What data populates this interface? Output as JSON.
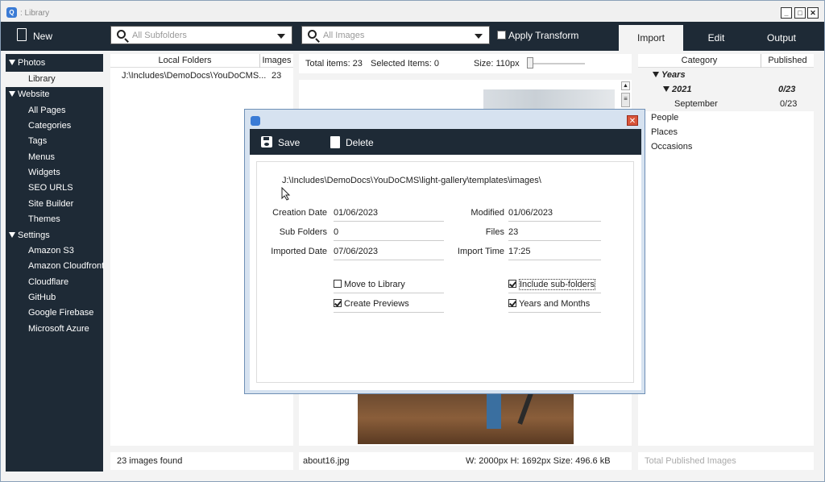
{
  "window": {
    "title": ": Library"
  },
  "toolbar": {
    "new_label": "New",
    "subfolders_placeholder": "All Subfolders",
    "images_placeholder": "All Images",
    "apply_transform_label": "Apply Transform",
    "tabs": [
      {
        "label": "Import",
        "active": true
      },
      {
        "label": "Edit",
        "active": false
      },
      {
        "label": "Output",
        "active": false
      }
    ]
  },
  "sidebar": {
    "groups": [
      {
        "label": "Photos",
        "items": [
          "Library"
        ]
      },
      {
        "label": "Website",
        "items": [
          "All Pages",
          "Categories",
          "Tags",
          "Menus",
          "Widgets",
          "SEO URLS",
          "Site Builder",
          "Themes"
        ]
      },
      {
        "label": "Settings",
        "items": [
          "Amazon S3",
          "Amazon Cloudfront",
          "Cloudflare",
          "GitHub",
          "Google Firebase",
          "Microsoft Azure"
        ]
      }
    ],
    "selected": "Library"
  },
  "folders": {
    "headers": [
      "Local Folders",
      "Images"
    ],
    "rows": [
      {
        "path": "J:\\Includes\\DemoDocs\\YouDoCMS...",
        "count": "23"
      }
    ],
    "status": "23 images found"
  },
  "middle": {
    "total_items": "Total items: 23",
    "selected_items": "Selected Items: 0",
    "size": "Size: 110px",
    "status_file": "about16.jpg",
    "status_dims": "W: 2000px  H: 1692px  Size: 496.6 kB"
  },
  "categories": {
    "headers": [
      "Category",
      "Published"
    ],
    "years_label": "Years",
    "year": "2021",
    "year_count": "0/23",
    "month": "September",
    "month_count": "0/23",
    "others": [
      "People",
      "Places",
      "Occasions"
    ],
    "status": "Total Published Images"
  },
  "dialog": {
    "save_label": "Save",
    "delete_label": "Delete",
    "path": "J:\\Includes\\DemoDocs\\YouDoCMS\\light-gallery\\templates\\images\\",
    "creation_date_label": "Creation Date",
    "creation_date": "01/06/2023",
    "modified_label": "Modified",
    "modified": "01/06/2023",
    "sub_folders_label": "Sub Folders",
    "sub_folders": "0",
    "files_label": "Files",
    "files": "23",
    "imported_date_label": "Imported Date",
    "imported_date": "07/06/2023",
    "import_time_label": "Import Time",
    "import_time": "17:25",
    "move_to_library_label": "Move to Library",
    "move_to_library": false,
    "include_subfolders_label": "Include sub-folders",
    "include_subfolders": true,
    "create_previews_label": "Create Previews",
    "create_previews": true,
    "years_months_label": "Years and Months",
    "years_months": true
  }
}
